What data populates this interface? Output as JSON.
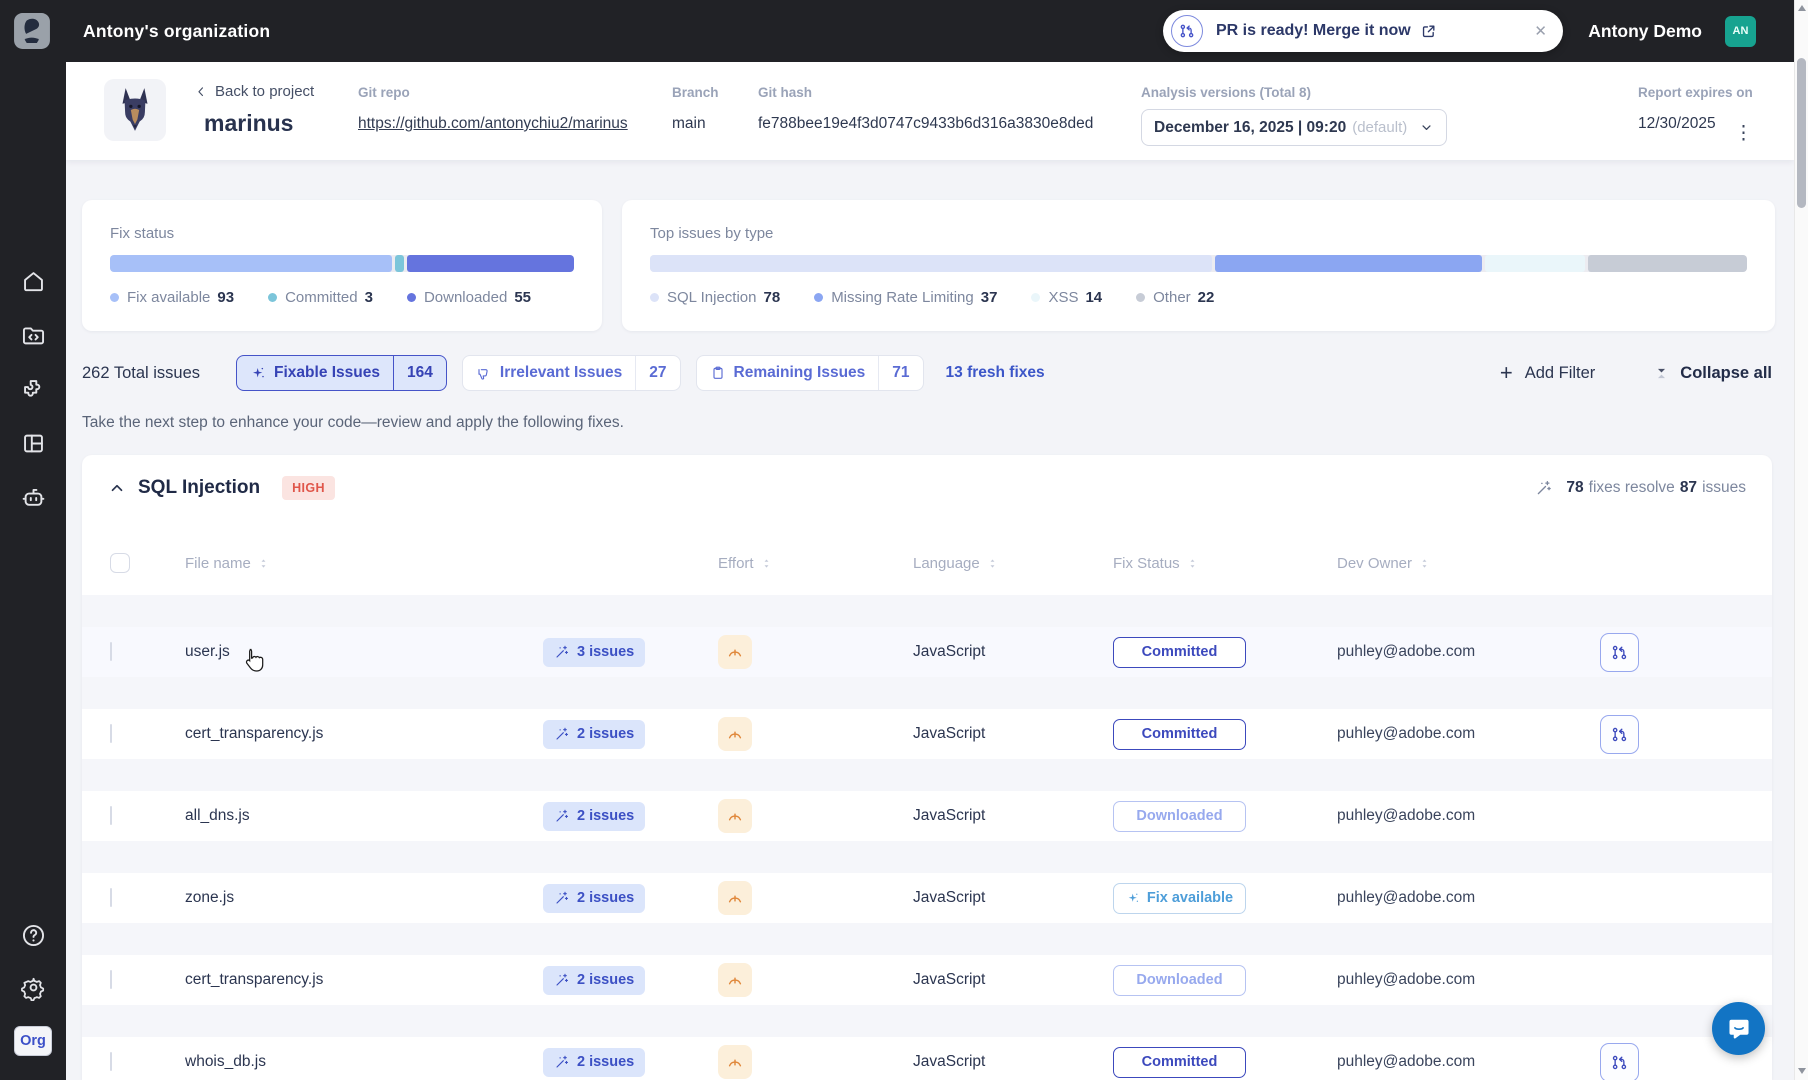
{
  "topbar": {
    "org_name": "Antony's organization",
    "pr_banner": {
      "text": "PR is ready! Merge it now"
    },
    "user_name": "Antony Demo",
    "avatar_initials": "AN"
  },
  "project_header": {
    "back_label": "Back to project",
    "project_name": "marinus",
    "git_repo_label": "Git repo",
    "git_repo_url": "https://github.com/antonychiu2/marinus",
    "branch_label": "Branch",
    "branch_value": "main",
    "git_hash_label": "Git hash",
    "git_hash_value": "fe788bee19e4f3d0747c9433b6d316a3830e8ded",
    "versions_label": "Analysis versions (Total 8)",
    "version_value": "December 16, 2025 | 09:20",
    "version_suffix": "(default)",
    "expires_label": "Report expires on",
    "expires_value": "12/30/2025"
  },
  "chart_data": [
    {
      "type": "bar",
      "variant": "stacked-horizontal",
      "title": "Fix status",
      "categories": [
        "Fix available",
        "Committed",
        "Downloaded"
      ],
      "values": [
        93,
        3,
        55
      ],
      "total": 151,
      "colors": [
        "#a7c0f8",
        "#7cc5da",
        "#6574de"
      ],
      "legend_position": "bottom"
    },
    {
      "type": "bar",
      "variant": "stacked-horizontal",
      "title": "Top issues by type",
      "categories": [
        "SQL Injection",
        "Missing Rate Limiting",
        "XSS",
        "Other"
      ],
      "values": [
        78,
        37,
        14,
        22
      ],
      "total": 151,
      "colors": [
        "#dce3f8",
        "#8ba6f2",
        "#eaf6fa",
        "#c7ccd6"
      ],
      "legend_position": "bottom"
    }
  ],
  "toolbar": {
    "total_label": "262 Total issues",
    "filters": [
      {
        "label": "Fixable Issues",
        "count": "164",
        "icon": "sparkle",
        "active": true
      },
      {
        "label": "Irrelevant Issues",
        "count": "27",
        "icon": "thumb",
        "active": false
      },
      {
        "label": "Remaining Issues",
        "count": "71",
        "icon": "clipboard",
        "active": false
      }
    ],
    "fresh_fixes": "13 fresh fixes",
    "add_filter_label": "Add Filter",
    "collapse_all_label": "Collapse all"
  },
  "subtitle": "Take the next step to enhance your code—review and apply the following fixes.",
  "issue_group": {
    "title": "SQL Injection",
    "severity": "HIGH",
    "summary_fixes": "78",
    "summary_mid": "fixes resolve",
    "summary_issues": "87",
    "summary_suffix": "issues"
  },
  "table": {
    "columns": [
      "File name",
      "Effort",
      "Language",
      "Fix Status",
      "Dev Owner"
    ],
    "rows": [
      {
        "file": "user.js",
        "issues_label": "3 issues",
        "language": "JavaScript",
        "status": "Committed",
        "status_kind": "committed",
        "owner": "puhley@adobe.com",
        "has_action": true,
        "hovered": true
      },
      {
        "file": "cert_transparency.js",
        "issues_label": "2 issues",
        "language": "JavaScript",
        "status": "Committed",
        "status_kind": "committed",
        "owner": "puhley@adobe.com",
        "has_action": true,
        "hovered": false
      },
      {
        "file": "all_dns.js",
        "issues_label": "2 issues",
        "language": "JavaScript",
        "status": "Downloaded",
        "status_kind": "downloaded",
        "owner": "puhley@adobe.com",
        "has_action": false,
        "hovered": false
      },
      {
        "file": "zone.js",
        "issues_label": "2 issues",
        "language": "JavaScript",
        "status": "Fix available",
        "status_kind": "available",
        "owner": "puhley@adobe.com",
        "has_action": false,
        "hovered": false
      },
      {
        "file": "cert_transparency.js",
        "issues_label": "2 issues",
        "language": "JavaScript",
        "status": "Downloaded",
        "status_kind": "downloaded",
        "owner": "puhley@adobe.com",
        "has_action": false,
        "hovered": false
      },
      {
        "file": "whois_db.js",
        "issues_label": "2 issues",
        "language": "JavaScript",
        "status": "Committed",
        "status_kind": "committed",
        "owner": "puhley@adobe.com",
        "has_action": true,
        "hovered": false
      }
    ]
  },
  "sidebar": {
    "items": [
      {
        "name": "home"
      },
      {
        "name": "projects"
      },
      {
        "name": "extensions"
      },
      {
        "name": "dashboard"
      },
      {
        "name": "assistant"
      }
    ],
    "bottom_items": [
      {
        "name": "help"
      },
      {
        "name": "settings"
      }
    ],
    "org_badge": "Org"
  },
  "icons": {
    "close": "✕",
    "kebab": "⋮",
    "plus": "+",
    "gear": "⚙"
  },
  "colors": {
    "accent": "#4553c8",
    "topbar_bg": "#212226",
    "severity_high_bg": "#fbe4e1",
    "severity_high_text": "#e0564a",
    "avatar_bg": "#17a390",
    "chat_bubble": "#1274c4"
  }
}
